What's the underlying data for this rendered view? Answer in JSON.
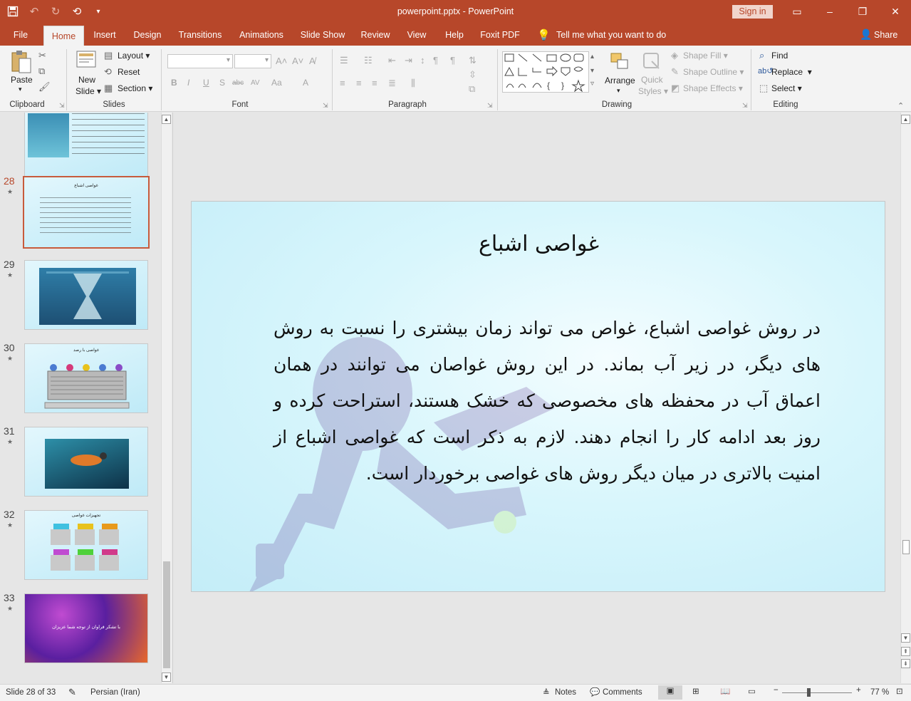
{
  "app": {
    "document_title": "powerpoint.pptx - PowerPoint",
    "sign_in": "Sign in",
    "share": "Share",
    "tell_me": "Tell me what you want to do",
    "qat_icons": [
      "save-icon",
      "undo-icon",
      "redo-icon",
      "present-icon",
      "customize-icon"
    ],
    "window_controls": [
      "ribbon-display-icon",
      "minimize-icon",
      "restore-icon",
      "close-icon"
    ]
  },
  "tabs": [
    {
      "label": "File"
    },
    {
      "label": "Home"
    },
    {
      "label": "Insert"
    },
    {
      "label": "Design"
    },
    {
      "label": "Transitions"
    },
    {
      "label": "Animations"
    },
    {
      "label": "Slide Show"
    },
    {
      "label": "Review"
    },
    {
      "label": "View"
    },
    {
      "label": "Help"
    },
    {
      "label": "Foxit PDF"
    }
  ],
  "active_tab": "Home",
  "ribbon": {
    "clipboard": {
      "label": "Clipboard",
      "paste": "Paste"
    },
    "slides": {
      "label": "Slides",
      "new_slide_1": "New",
      "new_slide_2": "Slide",
      "layout": "Layout",
      "reset": "Reset",
      "section": "Section"
    },
    "font": {
      "label": "Font",
      "buttons": [
        "B",
        "I",
        "U",
        "S",
        "abc",
        "AV",
        "Aa",
        "A"
      ]
    },
    "paragraph": {
      "label": "Paragraph"
    },
    "drawing": {
      "label": "Drawing",
      "arrange": "Arrange",
      "quick_styles_1": "Quick",
      "quick_styles_2": "Styles",
      "shape_fill": "Shape Fill",
      "shape_outline": "Shape Outline",
      "shape_effects": "Shape Effects"
    },
    "editing": {
      "label": "Editing",
      "find": "Find",
      "replace": "Replace",
      "select": "Select"
    }
  },
  "thumbnails": [
    {
      "number": "28",
      "title": "غواصی اشباع",
      "active": true
    },
    {
      "number": "29",
      "active": false
    },
    {
      "number": "30",
      "title": "غواصی با رصد",
      "active": false
    },
    {
      "number": "31",
      "active": false
    },
    {
      "number": "32",
      "title": "تجهیزات غواصی",
      "active": false
    },
    {
      "number": "33",
      "caption": "با تشکر فراوان از توجه شما عزیزان",
      "active": false
    }
  ],
  "slide": {
    "title": "غواصی اشباع",
    "body": "در روش غواصی اشباع، غواص می تواند زمان بیشتری را نسبت به روش های دیگر، در زیر آب بماند. در این روش غواصان می توانند در همان اعماق آب در محفظه های مخصوصی که خشک هستند، استراحت کرده و روز بعد ادامه کار را انجام دهند. لازم به ذکر است که غواصی اشباع از امنیت بالاتری در میان دیگر روش های غواصی برخوردار است."
  },
  "status": {
    "slide_info": "Slide 28 of 33",
    "language": "Persian (Iran)",
    "notes": "Notes",
    "comments": "Comments",
    "zoom": "77 %"
  },
  "colors": {
    "accent": "#b7472a",
    "slide_bg": "#d8f6fc"
  }
}
